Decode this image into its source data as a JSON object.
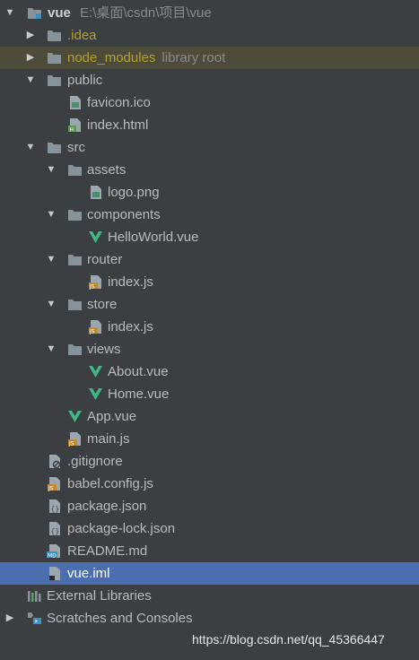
{
  "tree": {
    "root": {
      "label": "vue",
      "path": "E:\\桌面\\csdn\\项目\\vue"
    },
    "idea": {
      "label": ".idea"
    },
    "node_modules": {
      "label": "node_modules",
      "hint": "library root"
    },
    "public": {
      "label": "public"
    },
    "favicon": {
      "label": "favicon.ico"
    },
    "public_index": {
      "label": "index.html"
    },
    "src": {
      "label": "src"
    },
    "assets": {
      "label": "assets"
    },
    "logo": {
      "label": "logo.png"
    },
    "components": {
      "label": "components"
    },
    "helloworld": {
      "label": "HelloWorld.vue"
    },
    "router": {
      "label": "router"
    },
    "router_index": {
      "label": "index.js"
    },
    "store": {
      "label": "store"
    },
    "store_index": {
      "label": "index.js"
    },
    "views": {
      "label": "views"
    },
    "about": {
      "label": "About.vue"
    },
    "home": {
      "label": "Home.vue"
    },
    "app": {
      "label": "App.vue"
    },
    "main": {
      "label": "main.js"
    },
    "gitignore": {
      "label": ".gitignore"
    },
    "babel": {
      "label": "babel.config.js"
    },
    "package": {
      "label": "package.json"
    },
    "package_lock": {
      "label": "package-lock.json"
    },
    "readme": {
      "label": "README.md"
    },
    "vue_iml": {
      "label": "vue.iml"
    },
    "external": {
      "label": "External Libraries"
    },
    "scratches": {
      "label": "Scratches and Consoles"
    }
  },
  "icons": {
    "folder": "folder-icon",
    "vue": "vue-file-icon",
    "js": "js-file-icon",
    "image": "image-file-icon",
    "html": "html-file-icon",
    "json": "json-file-icon",
    "md": "markdown-file-icon",
    "iml": "iml-file-icon",
    "gitignore": "ignore-file-icon",
    "libraries": "libraries-icon",
    "scratches": "scratches-icon"
  },
  "colors": {
    "background": "#3c3f41",
    "selection": "#4b6eaf",
    "excluded_row": "#4d4b3a",
    "excluded_text": "#b3a233",
    "vue_green": "#41b883",
    "folder": "#87939a"
  },
  "watermark": "https://blog.csdn.net/qq_45366447"
}
